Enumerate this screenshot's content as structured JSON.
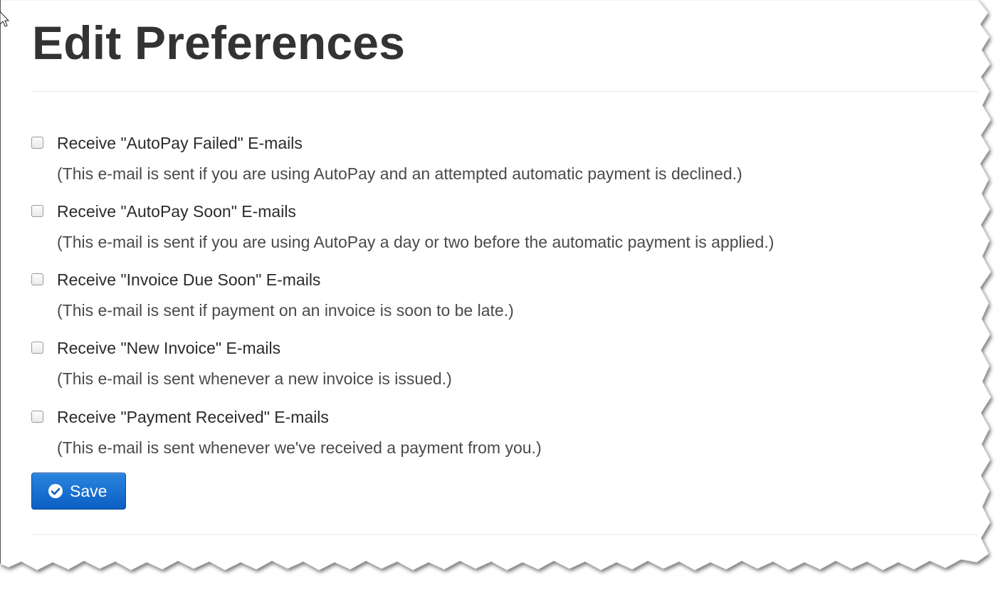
{
  "page": {
    "title": "Edit Preferences"
  },
  "preferences": [
    {
      "label": "Receive \"AutoPay Failed\" E-mails",
      "description": "(This e-mail is sent if you are using AutoPay and an attempted automatic payment is declined.)",
      "checked": false
    },
    {
      "label": "Receive \"AutoPay Soon\" E-mails",
      "description": "(This e-mail is sent if you are using AutoPay a day or two before the automatic payment is applied.)",
      "checked": false
    },
    {
      "label": "Receive \"Invoice Due Soon\" E-mails",
      "description": "(This e-mail is sent if payment on an invoice is soon to be late.)",
      "checked": false
    },
    {
      "label": "Receive \"New Invoice\" E-mails",
      "description": "(This e-mail is sent whenever a new invoice is issued.)",
      "checked": false
    },
    {
      "label": "Receive \"Payment Received\" E-mails",
      "description": "(This e-mail is sent whenever we've received a payment from you.)",
      "checked": false
    }
  ],
  "actions": {
    "save_label": "Save",
    "save_icon": "check-circle-icon"
  },
  "colors": {
    "title_text": "#333333",
    "button_primary": "#0b5fc3",
    "divider": "#e6e6e6"
  }
}
